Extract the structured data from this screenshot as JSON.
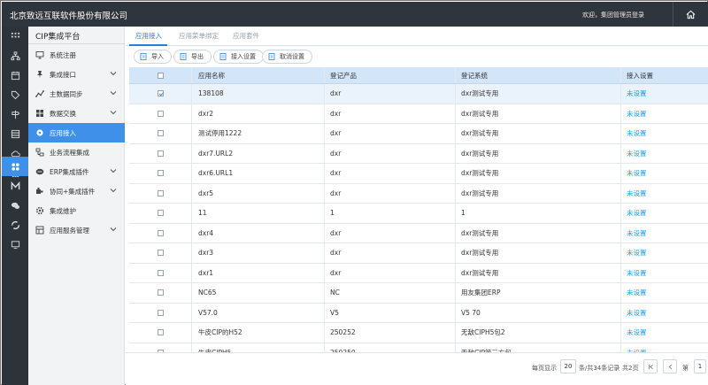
{
  "app": {
    "title": "北京致远互联软件股份有限公司",
    "welcome": "欢迎，集团管理员登录"
  },
  "sidebar": {
    "title": "CIP集成平台",
    "items": [
      {
        "label": "系统注册",
        "icon": "monitor-icon",
        "expandable": false
      },
      {
        "label": "集成接口",
        "icon": "pin-icon",
        "expandable": true
      },
      {
        "label": "主数据同步",
        "icon": "chart-line-icon",
        "expandable": true
      },
      {
        "label": "数据交换",
        "icon": "grid-icon",
        "expandable": true
      },
      {
        "label": "应用接入",
        "icon": "gear-icon",
        "expandable": false,
        "active": true
      },
      {
        "label": "业务流程集成",
        "icon": "flow-icon",
        "expandable": false
      },
      {
        "label": "ERP集成插件",
        "icon": "erp-icon",
        "expandable": true
      },
      {
        "label": "协同+集成插件",
        "icon": "plugin-icon",
        "expandable": true
      },
      {
        "label": "集成维护",
        "icon": "cog-icon",
        "expandable": false
      },
      {
        "label": "应用服务管理",
        "icon": "apps-icon",
        "expandable": true
      }
    ]
  },
  "tabs": [
    "应用接入",
    "应用菜单绑定",
    "应用套件"
  ],
  "toolbar": {
    "import": "导入",
    "export": "导出",
    "access_settings": "接入设置",
    "cancel_settings": "取消设置"
  },
  "table": {
    "columns": [
      "应用名称",
      "登记产品",
      "登记系统",
      "接入设置"
    ],
    "rows": [
      {
        "name": "138108",
        "product": "dxr",
        "system": "dxr测试专用",
        "setting": "未设置",
        "checked": true
      },
      {
        "name": "dxr2",
        "product": "dxr",
        "system": "dxr测试专用",
        "setting": "未设置",
        "checked": false
      },
      {
        "name": "测试停用1222",
        "product": "dxr",
        "system": "dxr测试专用",
        "setting": "未设置",
        "checked": false
      },
      {
        "name": "dxr7.URL2",
        "product": "dxr",
        "system": "dxr测试专用",
        "setting": "未设置",
        "checked": false
      },
      {
        "name": "dxr6.URL1",
        "product": "dxr",
        "system": "dxr测试专用",
        "setting": "未设置",
        "checked": false
      },
      {
        "name": "dxr5",
        "product": "dxr",
        "system": "dxr测试专用",
        "setting": "未设置",
        "checked": false
      },
      {
        "name": "11",
        "product": "1",
        "system": "1",
        "setting": "未设置",
        "checked": false
      },
      {
        "name": "dxr4",
        "product": "dxr",
        "system": "dxr测试专用",
        "setting": "未设置",
        "checked": false
      },
      {
        "name": "dxr3",
        "product": "dxr",
        "system": "dxr测试专用",
        "setting": "未设置",
        "checked": false
      },
      {
        "name": "dxr1",
        "product": "dxr",
        "system": "dxr测试专用",
        "setting": "未设置",
        "checked": false
      },
      {
        "name": "NC65",
        "product": "NC",
        "system": "用友集团ERP",
        "setting": "未设置",
        "checked": false
      },
      {
        "name": "V57.0",
        "product": "V5",
        "system": "V5 70",
        "setting": "未设置",
        "checked": false
      },
      {
        "name": "牛皮CIP的H52",
        "product": "250252",
        "system": "无敌CIPH5包2",
        "setting": "未设置",
        "checked": false
      },
      {
        "name": "牛皮CIPH5",
        "product": "250250",
        "system": "无敌CIP第三方包",
        "setting": "未设置",
        "checked": false
      }
    ]
  },
  "pagination": {
    "per_page_label": "每页显示",
    "page_size": "20",
    "records_label": "条/共34条记录",
    "pages_label": "共2页",
    "page_prefix": "第",
    "current_page": "1"
  },
  "colors": {
    "topbar": "#2f353c",
    "accent": "#3f90e8",
    "link": "#1a9df0",
    "table_header": "#d3e6f9"
  }
}
